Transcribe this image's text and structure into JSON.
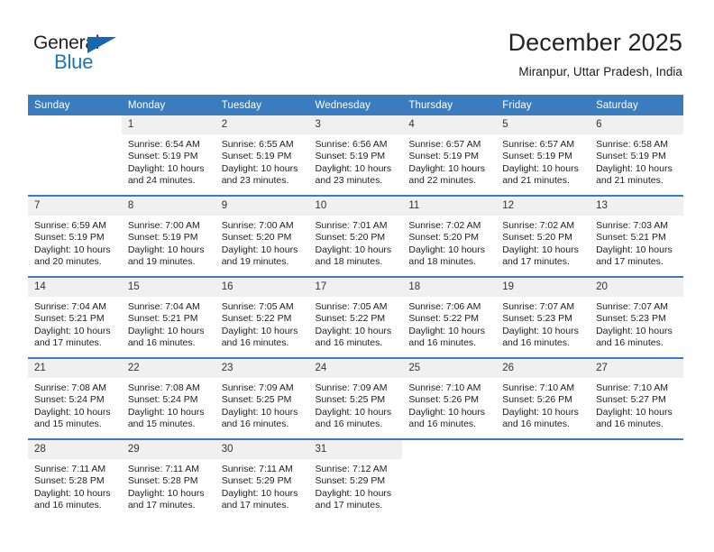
{
  "logo": {
    "word_one": "General",
    "word_two": "Blue",
    "triangle_icon": "triangle-icon",
    "accent_color": "#1a74c0"
  },
  "header": {
    "title": "December 2025",
    "subtitle": "Miranpur, Uttar Pradesh, India"
  },
  "theme": {
    "header_row_bg": "#3a7cbe",
    "daynum_bg": "#f0f0f0",
    "text_color": "#1d1d1d"
  },
  "weekday_headers": [
    "Sunday",
    "Monday",
    "Tuesday",
    "Wednesday",
    "Thursday",
    "Friday",
    "Saturday"
  ],
  "weeks": [
    [
      {
        "day": "",
        "sunrise": "",
        "sunset": "",
        "daylight_1": "",
        "daylight_2": "",
        "empty": true
      },
      {
        "day": "1",
        "sunrise": "Sunrise: 6:54 AM",
        "sunset": "Sunset: 5:19 PM",
        "daylight_1": "Daylight: 10 hours",
        "daylight_2": "and 24 minutes."
      },
      {
        "day": "2",
        "sunrise": "Sunrise: 6:55 AM",
        "sunset": "Sunset: 5:19 PM",
        "daylight_1": "Daylight: 10 hours",
        "daylight_2": "and 23 minutes."
      },
      {
        "day": "3",
        "sunrise": "Sunrise: 6:56 AM",
        "sunset": "Sunset: 5:19 PM",
        "daylight_1": "Daylight: 10 hours",
        "daylight_2": "and 23 minutes."
      },
      {
        "day": "4",
        "sunrise": "Sunrise: 6:57 AM",
        "sunset": "Sunset: 5:19 PM",
        "daylight_1": "Daylight: 10 hours",
        "daylight_2": "and 22 minutes."
      },
      {
        "day": "5",
        "sunrise": "Sunrise: 6:57 AM",
        "sunset": "Sunset: 5:19 PM",
        "daylight_1": "Daylight: 10 hours",
        "daylight_2": "and 21 minutes."
      },
      {
        "day": "6",
        "sunrise": "Sunrise: 6:58 AM",
        "sunset": "Sunset: 5:19 PM",
        "daylight_1": "Daylight: 10 hours",
        "daylight_2": "and 21 minutes."
      }
    ],
    [
      {
        "day": "7",
        "sunrise": "Sunrise: 6:59 AM",
        "sunset": "Sunset: 5:19 PM",
        "daylight_1": "Daylight: 10 hours",
        "daylight_2": "and 20 minutes."
      },
      {
        "day": "8",
        "sunrise": "Sunrise: 7:00 AM",
        "sunset": "Sunset: 5:19 PM",
        "daylight_1": "Daylight: 10 hours",
        "daylight_2": "and 19 minutes."
      },
      {
        "day": "9",
        "sunrise": "Sunrise: 7:00 AM",
        "sunset": "Sunset: 5:20 PM",
        "daylight_1": "Daylight: 10 hours",
        "daylight_2": "and 19 minutes."
      },
      {
        "day": "10",
        "sunrise": "Sunrise: 7:01 AM",
        "sunset": "Sunset: 5:20 PM",
        "daylight_1": "Daylight: 10 hours",
        "daylight_2": "and 18 minutes."
      },
      {
        "day": "11",
        "sunrise": "Sunrise: 7:02 AM",
        "sunset": "Sunset: 5:20 PM",
        "daylight_1": "Daylight: 10 hours",
        "daylight_2": "and 18 minutes."
      },
      {
        "day": "12",
        "sunrise": "Sunrise: 7:02 AM",
        "sunset": "Sunset: 5:20 PM",
        "daylight_1": "Daylight: 10 hours",
        "daylight_2": "and 17 minutes."
      },
      {
        "day": "13",
        "sunrise": "Sunrise: 7:03 AM",
        "sunset": "Sunset: 5:21 PM",
        "daylight_1": "Daylight: 10 hours",
        "daylight_2": "and 17 minutes."
      }
    ],
    [
      {
        "day": "14",
        "sunrise": "Sunrise: 7:04 AM",
        "sunset": "Sunset: 5:21 PM",
        "daylight_1": "Daylight: 10 hours",
        "daylight_2": "and 17 minutes."
      },
      {
        "day": "15",
        "sunrise": "Sunrise: 7:04 AM",
        "sunset": "Sunset: 5:21 PM",
        "daylight_1": "Daylight: 10 hours",
        "daylight_2": "and 16 minutes."
      },
      {
        "day": "16",
        "sunrise": "Sunrise: 7:05 AM",
        "sunset": "Sunset: 5:22 PM",
        "daylight_1": "Daylight: 10 hours",
        "daylight_2": "and 16 minutes."
      },
      {
        "day": "17",
        "sunrise": "Sunrise: 7:05 AM",
        "sunset": "Sunset: 5:22 PM",
        "daylight_1": "Daylight: 10 hours",
        "daylight_2": "and 16 minutes."
      },
      {
        "day": "18",
        "sunrise": "Sunrise: 7:06 AM",
        "sunset": "Sunset: 5:22 PM",
        "daylight_1": "Daylight: 10 hours",
        "daylight_2": "and 16 minutes."
      },
      {
        "day": "19",
        "sunrise": "Sunrise: 7:07 AM",
        "sunset": "Sunset: 5:23 PM",
        "daylight_1": "Daylight: 10 hours",
        "daylight_2": "and 16 minutes."
      },
      {
        "day": "20",
        "sunrise": "Sunrise: 7:07 AM",
        "sunset": "Sunset: 5:23 PM",
        "daylight_1": "Daylight: 10 hours",
        "daylight_2": "and 16 minutes."
      }
    ],
    [
      {
        "day": "21",
        "sunrise": "Sunrise: 7:08 AM",
        "sunset": "Sunset: 5:24 PM",
        "daylight_1": "Daylight: 10 hours",
        "daylight_2": "and 15 minutes."
      },
      {
        "day": "22",
        "sunrise": "Sunrise: 7:08 AM",
        "sunset": "Sunset: 5:24 PM",
        "daylight_1": "Daylight: 10 hours",
        "daylight_2": "and 15 minutes."
      },
      {
        "day": "23",
        "sunrise": "Sunrise: 7:09 AM",
        "sunset": "Sunset: 5:25 PM",
        "daylight_1": "Daylight: 10 hours",
        "daylight_2": "and 16 minutes."
      },
      {
        "day": "24",
        "sunrise": "Sunrise: 7:09 AM",
        "sunset": "Sunset: 5:25 PM",
        "daylight_1": "Daylight: 10 hours",
        "daylight_2": "and 16 minutes."
      },
      {
        "day": "25",
        "sunrise": "Sunrise: 7:10 AM",
        "sunset": "Sunset: 5:26 PM",
        "daylight_1": "Daylight: 10 hours",
        "daylight_2": "and 16 minutes."
      },
      {
        "day": "26",
        "sunrise": "Sunrise: 7:10 AM",
        "sunset": "Sunset: 5:26 PM",
        "daylight_1": "Daylight: 10 hours",
        "daylight_2": "and 16 minutes."
      },
      {
        "day": "27",
        "sunrise": "Sunrise: 7:10 AM",
        "sunset": "Sunset: 5:27 PM",
        "daylight_1": "Daylight: 10 hours",
        "daylight_2": "and 16 minutes."
      }
    ],
    [
      {
        "day": "28",
        "sunrise": "Sunrise: 7:11 AM",
        "sunset": "Sunset: 5:28 PM",
        "daylight_1": "Daylight: 10 hours",
        "daylight_2": "and 16 minutes."
      },
      {
        "day": "29",
        "sunrise": "Sunrise: 7:11 AM",
        "sunset": "Sunset: 5:28 PM",
        "daylight_1": "Daylight: 10 hours",
        "daylight_2": "and 17 minutes."
      },
      {
        "day": "30",
        "sunrise": "Sunrise: 7:11 AM",
        "sunset": "Sunset: 5:29 PM",
        "daylight_1": "Daylight: 10 hours",
        "daylight_2": "and 17 minutes."
      },
      {
        "day": "31",
        "sunrise": "Sunrise: 7:12 AM",
        "sunset": "Sunset: 5:29 PM",
        "daylight_1": "Daylight: 10 hours",
        "daylight_2": "and 17 minutes."
      },
      {
        "day": "",
        "sunrise": "",
        "sunset": "",
        "daylight_1": "",
        "daylight_2": "",
        "empty": true
      },
      {
        "day": "",
        "sunrise": "",
        "sunset": "",
        "daylight_1": "",
        "daylight_2": "",
        "empty": true
      },
      {
        "day": "",
        "sunrise": "",
        "sunset": "",
        "daylight_1": "",
        "daylight_2": "",
        "empty": true
      }
    ]
  ]
}
